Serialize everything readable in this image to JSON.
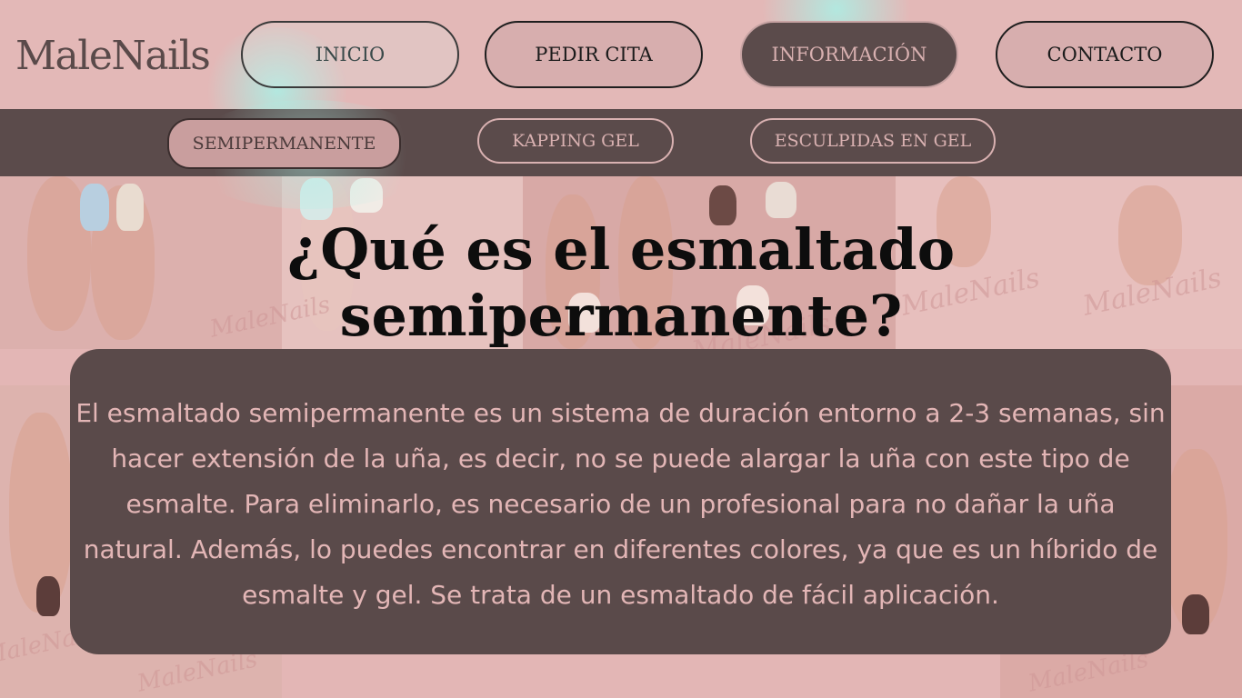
{
  "brand": {
    "logo": "MaleNails"
  },
  "nav": {
    "items": [
      {
        "label": "INICIO"
      },
      {
        "label": "PEDIR CITA"
      },
      {
        "label": "INFORMACIÓN"
      },
      {
        "label": "CONTACTO"
      }
    ],
    "active": "INFORMACIÓN"
  },
  "subnav": {
    "items": [
      {
        "label": "SEMIPERMANENTE"
      },
      {
        "label": "KAPPING GEL"
      },
      {
        "label": "ESCULPIDAS EN GEL"
      }
    ],
    "active": "SEMIPERMANENTE"
  },
  "main": {
    "title": "¿Qué es el esmaltado semipermanente?",
    "description": "El esmaltado semipermanente es un sistema de duración entorno a 2-3 semanas, sin hacer extensión de la uña, es decir, no se puede alargar la uña con este tipo de esmalte. Para eliminarlo, es necesario de un profesional para no dañar la uña natural. Además, lo puedes encontrar en diferentes colores, ya que es un híbrido de esmalte y gel. Se trata de un esmaltado de fácil aplicación."
  },
  "background": {
    "watermark": "MaleNails"
  },
  "colors": {
    "header_bg": "#e3b8b7",
    "dark": "#5b4b4b",
    "pink": "#d9b1b1",
    "glow": "#aaf0e6"
  }
}
